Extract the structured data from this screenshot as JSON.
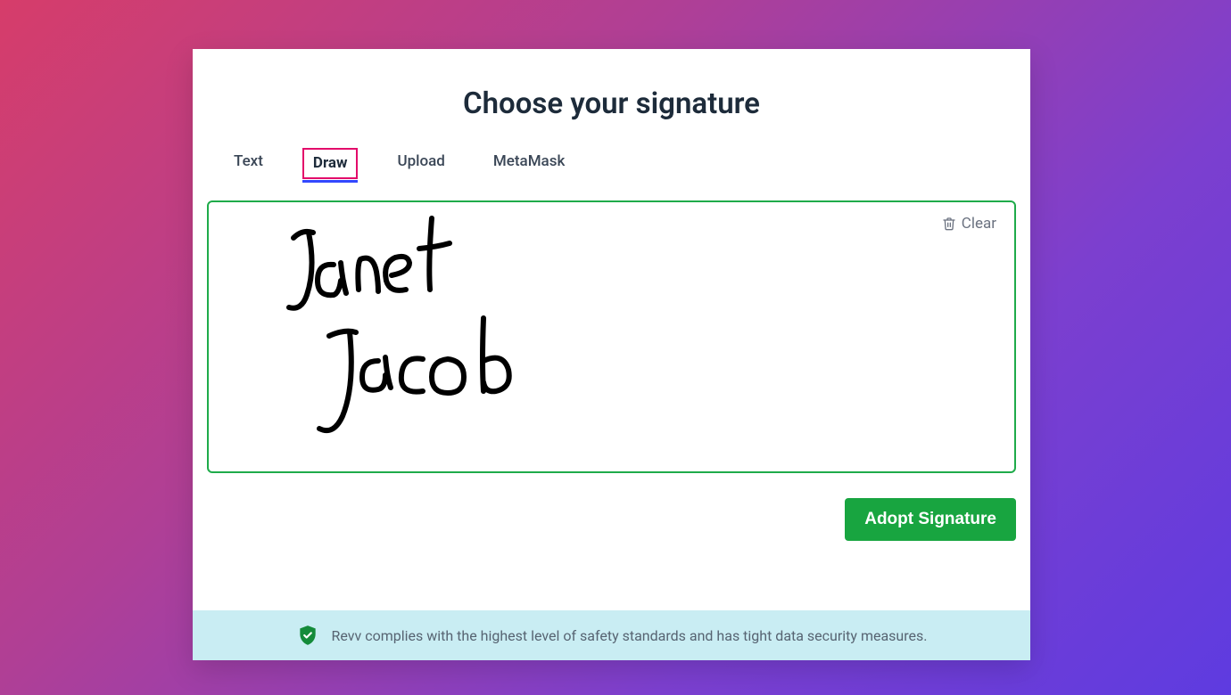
{
  "modal": {
    "title": "Choose your signature",
    "tabs": [
      "Text",
      "Draw",
      "Upload",
      "MetaMask"
    ],
    "active_tab": "Draw",
    "clear_label": "Clear",
    "signature_drawn_text": "Janet Jacob"
  },
  "actions": {
    "adopt_label": "Adopt Signature"
  },
  "footer": {
    "message": "Revv complies with the highest level of safety standards and has tight data security measures."
  },
  "colors": {
    "accent_green": "#18a540",
    "canvas_border": "#1fab4a",
    "tab_highlight_border": "#e30b6a",
    "tab_underline": "#3348ff",
    "footer_bg": "#c9edf3"
  }
}
